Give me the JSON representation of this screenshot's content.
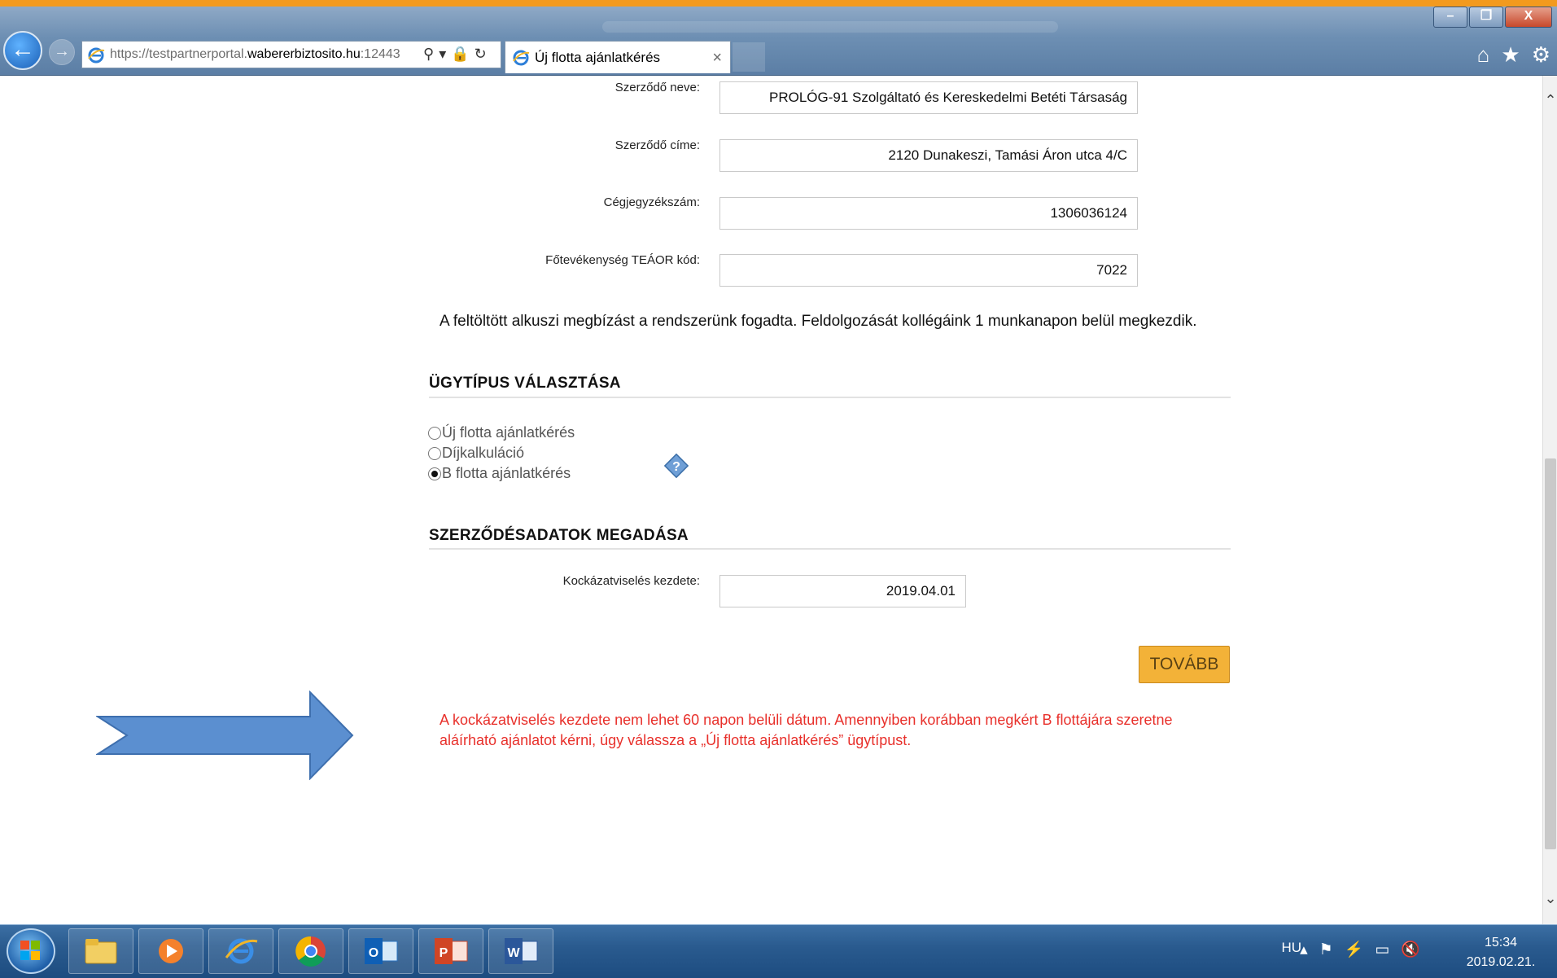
{
  "browser": {
    "url_prefix": "https://testpartnerportal.",
    "url_domain": "wabererbiztosito.hu",
    "url_suffix": ":12443",
    "tab_title": "Új flotta ajánlatkérés",
    "tab_close": "×",
    "window_buttons": {
      "minimize": "–",
      "restore": "❐",
      "close": "X"
    }
  },
  "form": {
    "contractor_name_label": "Szerződő neve:",
    "contractor_name_value": "PROLÓG-91 Szolgáltató és Kereskedelmi Betéti Társaság",
    "contractor_address_label": "Szerződő címe:",
    "contractor_address_value": "2120 Dunakeszi, Tamási Áron utca 4/C",
    "company_reg_label": "Cégjegyzékszám:",
    "company_reg_value": "1306036124",
    "teaor_label": "Főtevékenység TEÁOR kód:",
    "teaor_value": "7022"
  },
  "info_message": "A feltöltött alkuszi megbízást a rendszerünk fogadta. Feldolgozását kollégáink 1 munkanapon belül megkezdik.",
  "case_type": {
    "title": "ÜGYTÍPUS VÁLASZTÁSA",
    "options": [
      {
        "label": "Új flotta ajánlatkérés",
        "checked": false
      },
      {
        "label": "Díjkalkuláció",
        "checked": false
      },
      {
        "label": "B flotta ajánlatkérés",
        "checked": true
      }
    ]
  },
  "contract_data": {
    "title": "SZERZŐDÉSADATOK MEGADÁSA",
    "risk_start_label": "Kockázatviselés kezdete:",
    "risk_start_value": "2019.04.01"
  },
  "next_button": "TOVÁBB",
  "error_message_line1": "A kockázatviselés kezdete nem lehet 60 napon belüli dátum. Amennyiben korábban megkért B flottájára szeretne",
  "error_message_line2": "aláírható ajánlatot kérni, úgy válassza a „Új flotta ajánlatkérés” ügytípust.",
  "taskbar": {
    "apps": [
      "file-explorer",
      "media-player",
      "internet-explorer",
      "chrome",
      "outlook",
      "powerpoint",
      "word"
    ],
    "language": "HU",
    "time": "15:34",
    "date": "2019.02.21."
  },
  "colors": {
    "accent_orange": "#f3b238",
    "error_red": "#e8302b",
    "arrow_blue": "#5b8fd0",
    "top_strip": "#f39a1e"
  }
}
